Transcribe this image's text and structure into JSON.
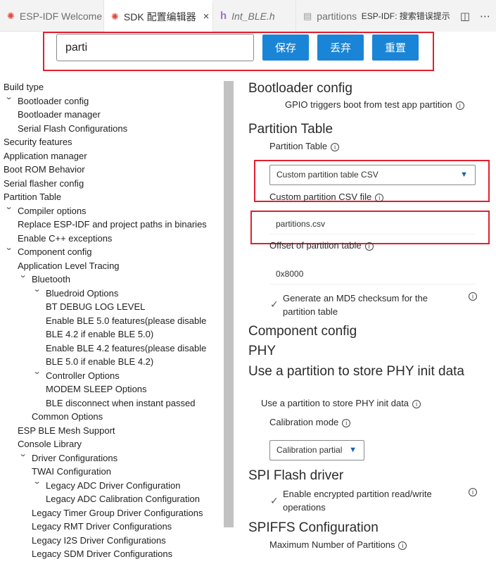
{
  "tabs": [
    {
      "label": "ESP-IDF Welcome",
      "icon": "esp-icon"
    },
    {
      "label": "SDK 配置编辑器",
      "icon": "esp-icon",
      "close": "×"
    },
    {
      "label": "Int_BLE.h",
      "icon": "h-file-icon"
    },
    {
      "label": "partitions.",
      "icon": "file-icon"
    }
  ],
  "tabbar_right": {
    "text": "ESP-IDF:  搜索错误提示"
  },
  "search": {
    "value": "parti"
  },
  "buttons": {
    "save": "保存",
    "discard": "丢弃",
    "reset": "重置"
  },
  "colors": {
    "accent": "#1a85d6",
    "highlight": "#e0202f"
  },
  "tree": [
    {
      "label": "Build type",
      "depth": 0,
      "chev": false
    },
    {
      "label": "Bootloader config",
      "depth": 1,
      "chev": true
    },
    {
      "label": "Bootloader manager",
      "depth": 2,
      "chev": false
    },
    {
      "label": "Serial Flash Configurations",
      "depth": 2,
      "chev": false
    },
    {
      "label": "Security features",
      "depth": 0,
      "chev": false
    },
    {
      "label": "Application manager",
      "depth": 0,
      "chev": false
    },
    {
      "label": "Boot ROM Behavior",
      "depth": 0,
      "chev": false
    },
    {
      "label": "Serial flasher config",
      "depth": 0,
      "chev": false
    },
    {
      "label": "Partition Table",
      "depth": 0,
      "chev": false
    },
    {
      "label": "Compiler options",
      "depth": 1,
      "chev": true
    },
    {
      "label": "Replace ESP-IDF and project paths in binaries",
      "depth": 2,
      "chev": false
    },
    {
      "label": "Enable C++ exceptions",
      "depth": 2,
      "chev": false
    },
    {
      "label": "Component config",
      "depth": 1,
      "chev": true
    },
    {
      "label": "Application Level Tracing",
      "depth": 2,
      "chev": false
    },
    {
      "label": "Bluetooth",
      "depth": 3,
      "chev": true
    },
    {
      "label": "Bluedroid Options",
      "depth": 5,
      "chev": true
    },
    {
      "label": "BT DEBUG LOG LEVEL",
      "depth": 6,
      "chev": false
    },
    {
      "label": "Enable BLE 5.0 features(please disable",
      "depth": 6,
      "chev": false
    },
    {
      "label": "BLE 4.2 if enable BLE 5.0)",
      "depth": 6,
      "chev": false
    },
    {
      "label": "Enable BLE 4.2 features(please disable",
      "depth": 6,
      "chev": false
    },
    {
      "label": "BLE 5.0 if enable BLE 4.2)",
      "depth": 6,
      "chev": false
    },
    {
      "label": "Controller Options",
      "depth": 5,
      "chev": true
    },
    {
      "label": "MODEM SLEEP Options",
      "depth": 6,
      "chev": false
    },
    {
      "label": "BLE disconnect when instant passed",
      "depth": 6,
      "chev": false
    },
    {
      "label": "Common Options",
      "depth": 4,
      "chev": false
    },
    {
      "label": "ESP BLE Mesh Support",
      "depth": 2,
      "chev": false
    },
    {
      "label": "Console Library",
      "depth": 2,
      "chev": false
    },
    {
      "label": "Driver Configurations",
      "depth": 3,
      "chev": true
    },
    {
      "label": "TWAI Configuration",
      "depth": 4,
      "chev": false
    },
    {
      "label": "Legacy ADC Driver Configuration",
      "depth": 5,
      "chev": true
    },
    {
      "label": "Legacy ADC Calibration Configuration",
      "depth": 6,
      "chev": false
    },
    {
      "label": "Legacy Timer Group Driver Configurations",
      "depth": 4,
      "chev": false
    },
    {
      "label": "Legacy RMT Driver Configurations",
      "depth": 4,
      "chev": false
    },
    {
      "label": "Legacy I2S Driver Configurations",
      "depth": 4,
      "chev": false
    },
    {
      "label": "Legacy SDM Driver Configurations",
      "depth": 4,
      "chev": false
    }
  ],
  "panel": {
    "bootloader_title": "Bootloader config",
    "gpio_label": "GPIO triggers boot from test app partition",
    "partition_title": "Partition Table",
    "partition_label": "Partition Table",
    "partition_select": "Custom partition table CSV",
    "csv_label": "Custom partition CSV file",
    "csv_value": "partitions.csv",
    "offset_label": "Offset of partition table",
    "offset_value": "0x8000",
    "md5_line1": "Generate an MD5 checksum for the",
    "md5_line2": "partition table",
    "component_title": "Component config",
    "phy_title": "PHY",
    "phy_partition_title": "Use a partition to store PHY init data",
    "phy_partition_label": "Use a partition to store PHY init data",
    "calibration_label": "Calibration mode",
    "calibration_select": "Calibration partial",
    "spi_title": "SPI Flash driver",
    "encrypt_line1": "Enable encrypted partition read/write",
    "encrypt_line2": "operations",
    "spiffs_title": "SPIFFS Configuration",
    "max_partitions_label": "Maximum Number of Partitions"
  }
}
